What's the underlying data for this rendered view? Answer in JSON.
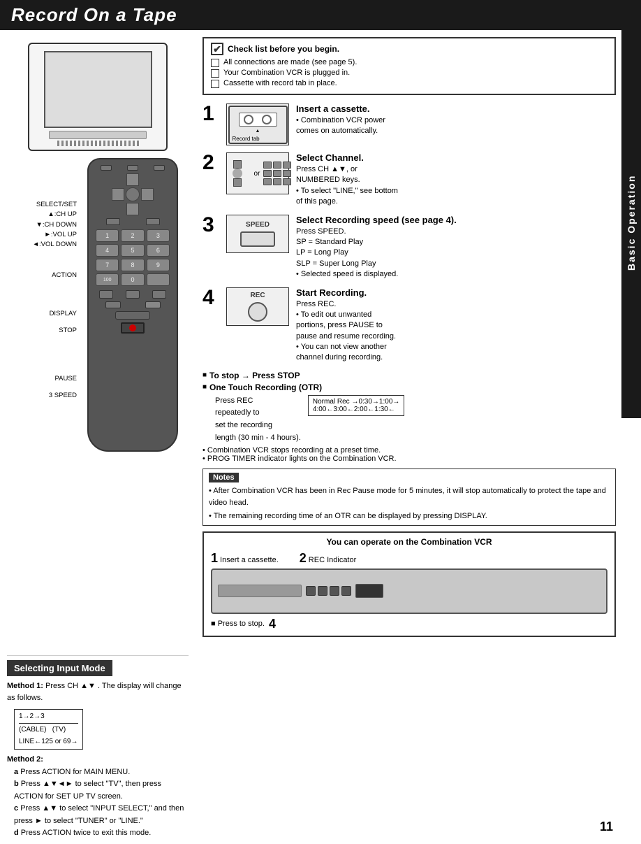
{
  "header": {
    "title": "Record On a Tape"
  },
  "sidebar": {
    "label": "Basic Operation"
  },
  "checklist": {
    "title": "Check list before you begin.",
    "items": [
      "All connections are made (see page 5).",
      "Your Combination VCR is plugged in.",
      "Cassette with record tab in place."
    ]
  },
  "steps": [
    {
      "number": "1",
      "title": "Insert a cassette.",
      "lines": [
        "• Combination VCR power",
        "  comes on automatically."
      ],
      "image_label": "cassette"
    },
    {
      "number": "2",
      "title": "Select Channel.",
      "lines": [
        "Press CH ▲▼, or",
        "NUMBERED keys.",
        "• To select \"LINE,\" see bottom",
        "  of this page."
      ],
      "image_label": "channel"
    },
    {
      "number": "3",
      "title": "Select Recording speed (see page 4).",
      "lines": [
        "Press SPEED.",
        "SP  = Standard Play",
        "LP  = Long Play",
        "SLP = Super Long Play",
        "• Selected speed is displayed."
      ],
      "image_label": "speed"
    },
    {
      "number": "4",
      "title": "Start Recording.",
      "lines": [
        "Press REC.",
        "• To edit out unwanted",
        "  portions, press PAUSE to",
        "  pause and resume recording.",
        "• You can not view another",
        "  channel during recording."
      ],
      "image_label": "rec"
    }
  ],
  "to_stop": "To stop → Press STOP",
  "otr": {
    "title": "One Touch Recording (OTR)",
    "desc1": "Press REC",
    "desc2": "repeatedly to",
    "desc3": "set the recording",
    "desc4": "length (30 min - 4 hours).",
    "flow": [
      "Normal Rec",
      "→0:30",
      "→1:00",
      "→",
      "4:00",
      "←3:00",
      "←2:00",
      "←1:30"
    ],
    "bullet1": "• Combination VCR stops recording at a preset time.",
    "bullet2": "• PROG TIMER indicator lights on the Combination VCR."
  },
  "notes": {
    "title": "Notes",
    "items": [
      "After Combination VCR has been in Rec Pause mode for 5 minutes, it will stop automatically to protect the tape and video head.",
      "The remaining recording time of an OTR can be displayed by pressing DISPLAY."
    ]
  },
  "vcr_section": {
    "title": "You can operate on the Combination VCR",
    "steps": [
      {
        "number": "1",
        "label": "Insert a cassette."
      },
      {
        "number": "2",
        "label": "REC Indicator"
      }
    ],
    "press_to_stop": "■ Press to stop.",
    "step4": "4"
  },
  "selecting_input": {
    "title": "Selecting Input Mode",
    "method1_label": "Method 1:",
    "method1_text": "Press CH ▲▼ . The display will change as follows.",
    "flow_items": [
      "1",
      "→2",
      "→3"
    ],
    "flow_line": "(CABLE)   (TV)",
    "flow_bottom": "LINE←125 or 69→",
    "method2_label": "Method 2:",
    "steps": [
      {
        "letter": "a",
        "text": "Press ACTION for MAIN MENU."
      },
      {
        "letter": "b",
        "text": "Press ▲▼◄► to select \"TV\", then press ACTION for SET UP TV screen."
      },
      {
        "letter": "c",
        "text": "Press ▲▼ to select \"INPUT SELECT,\" and then press ► to select \"TUNER\" or \"LINE.\""
      },
      {
        "letter": "d",
        "text": "Press ACTION twice to exit this mode."
      }
    ]
  },
  "remote_labels": {
    "select_set": "SELECT/SET",
    "ch_up": "▲:CH UP",
    "ch_down": "▼:CH DOWN",
    "vol_up": "►:VOL UP",
    "vol_down": "◄:VOL DOWN",
    "action": "ACTION",
    "display": "DISPLAY",
    "stop": "STOP",
    "pause": "PAUSE",
    "speed": "3 SPEED"
  },
  "page_number": "11",
  "record_tab_label": "Record tab"
}
